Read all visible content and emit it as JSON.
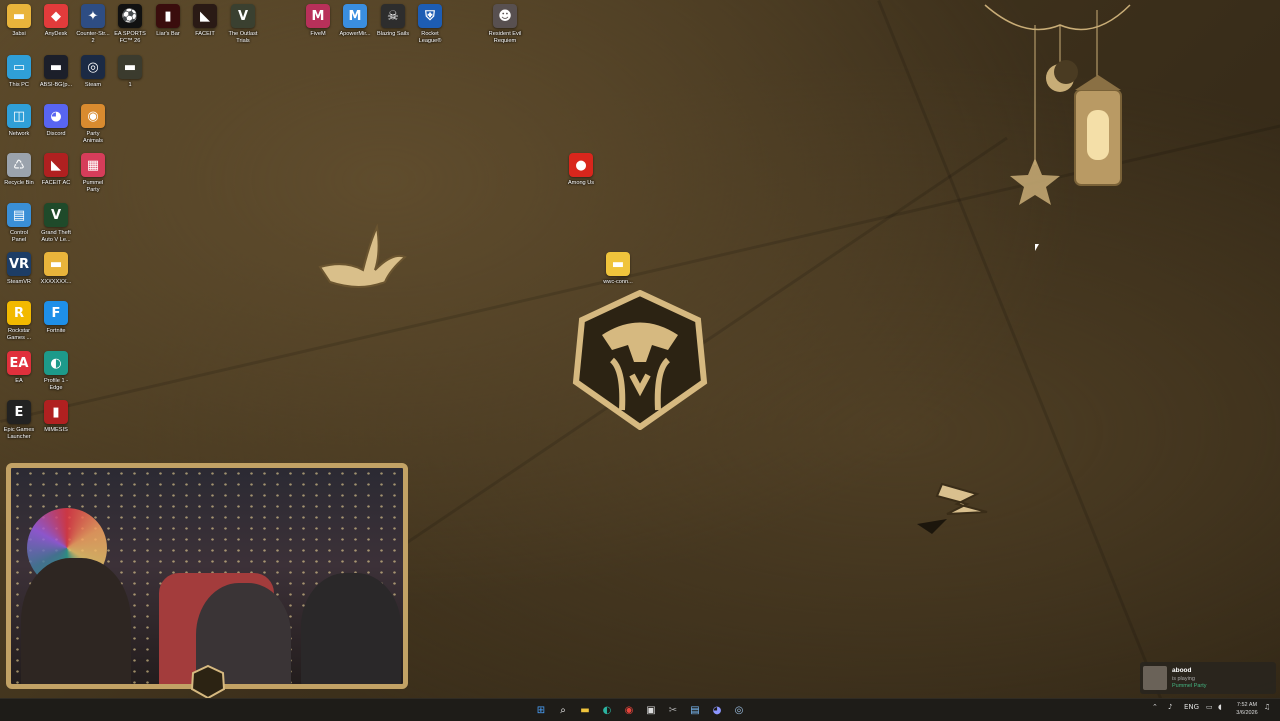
{
  "desktop_icons": [
    {
      "label": "3absi",
      "glyph": "▬",
      "color": "#e9b43b",
      "icon": "folder-icon"
    },
    {
      "label": "AnyDesk",
      "glyph": "◆",
      "color": "#e23b3b",
      "icon": "anydesk-icon"
    },
    {
      "label": "Counter-Str...\n2",
      "glyph": "✦",
      "color": "#2e4d83",
      "icon": "counter-strike-icon"
    },
    {
      "label": "EA SPORTS\nFC™ 26",
      "glyph": "⚽",
      "color": "#111",
      "icon": "ea-fc-icon"
    },
    {
      "label": "Liar's Bar",
      "glyph": "▮",
      "color": "#3a0d0d",
      "icon": "liars-bar-icon"
    },
    {
      "label": "FACEIT",
      "glyph": "◣",
      "color": "#2a1a15",
      "icon": "faceit-icon"
    },
    {
      "label": "The Outlast\nTrials",
      "glyph": "V",
      "color": "#3a4030",
      "icon": "outlast-trials-icon"
    },
    {
      "label": "FiveM",
      "glyph": "M",
      "color": "#b8305a",
      "icon": "fivem-icon"
    },
    {
      "label": "ApowerMir...",
      "glyph": "M",
      "color": "#3a8ee0",
      "icon": "apowermirror-icon"
    },
    {
      "label": "Blazing Sails",
      "glyph": "☠",
      "color": "#2d2d2d",
      "icon": "blazing-sails-icon"
    },
    {
      "label": "Rocket\nLeague®",
      "glyph": "⛨",
      "color": "#1d5db4",
      "icon": "rocket-league-icon"
    },
    {
      "label": "Resident Evil\nRequiem",
      "glyph": "☻",
      "color": "#585050",
      "icon": "resident-evil-icon"
    },
    {
      "label": "This PC",
      "glyph": "▭",
      "color": "#2f9fd8",
      "icon": "this-pc-icon"
    },
    {
      "label": "ABSI-BG(p...",
      "glyph": "▬",
      "color": "#1c1f2a",
      "icon": "image-file-icon"
    },
    {
      "label": "Steam",
      "glyph": "◎",
      "color": "#1b2a44",
      "icon": "steam-icon"
    },
    {
      "label": "1",
      "glyph": "▬",
      "color": "#3b3b2e",
      "icon": "image-file-icon"
    },
    {
      "label": "Network",
      "glyph": "◫",
      "color": "#2f9fd8",
      "icon": "network-icon"
    },
    {
      "label": "Discord",
      "glyph": "◕",
      "color": "#5865f2",
      "icon": "discord-icon"
    },
    {
      "label": "Party\nAnimals",
      "glyph": "◉",
      "color": "#d98b2f",
      "icon": "party-animals-icon"
    },
    {
      "label": "Recycle Bin",
      "glyph": "♺",
      "color": "#9ba3ad",
      "icon": "recycle-bin-icon"
    },
    {
      "label": "FACEIT AC",
      "glyph": "◣",
      "color": "#b02020",
      "icon": "faceit-ac-icon"
    },
    {
      "label": "Pummel\nParty",
      "glyph": "▦",
      "color": "#d63d5a",
      "icon": "pummel-party-icon"
    },
    {
      "label": "Control\nPanel",
      "glyph": "▤",
      "color": "#3a8fd6",
      "icon": "control-panel-icon"
    },
    {
      "label": "Grand Theft\nAuto V Le...",
      "glyph": "V",
      "color": "#1f4a2a",
      "icon": "gta-v-icon"
    },
    {
      "label": "SteamVR",
      "glyph": "VR",
      "color": "#1d3d66",
      "icon": "steamvr-icon"
    },
    {
      "label": "XXXXXXX...",
      "glyph": "▬",
      "color": "#e9b43b",
      "icon": "folder-icon"
    },
    {
      "label": "Rockstar\nGames ...",
      "glyph": "R",
      "color": "#f2b900",
      "icon": "rockstar-icon"
    },
    {
      "label": "Fortnite",
      "glyph": "F",
      "color": "#1e8fe8",
      "icon": "fortnite-icon"
    },
    {
      "label": "EA",
      "glyph": "EA",
      "color": "#e0303c",
      "icon": "ea-icon"
    },
    {
      "label": "Profile 1 -\nEdge",
      "glyph": "◐",
      "color": "#1d9a8a",
      "icon": "edge-icon"
    },
    {
      "label": "Epic Games\nLauncher",
      "glyph": "E",
      "color": "#222",
      "icon": "epic-games-icon"
    },
    {
      "label": "MIMESIS",
      "glyph": "▮",
      "color": "#b02020",
      "icon": "mimesis-icon"
    },
    {
      "label": "Among Us",
      "glyph": "●",
      "color": "#d9261c",
      "icon": "among-us-icon"
    },
    {
      "label": "wwc-conn...",
      "glyph": "▬",
      "color": "#f0c43c",
      "icon": "folder-icon"
    }
  ],
  "notification": {
    "user": "abood",
    "status": "is playing",
    "game": "Pummel Party"
  },
  "tray": {
    "language": "ENG",
    "time": "7:52 AM",
    "date": "3/6/2026"
  },
  "taskbar_icons": [
    "windows-start-icon",
    "search-icon",
    "file-explorer-icon",
    "edge-icon",
    "chrome-icon",
    "store-icon",
    "snipping-tool-icon",
    "notepad-icon",
    "discord-icon",
    "steam-icon"
  ],
  "colors": {
    "accent_gold": "#c2a265",
    "taskbar": "#1e1c18"
  }
}
